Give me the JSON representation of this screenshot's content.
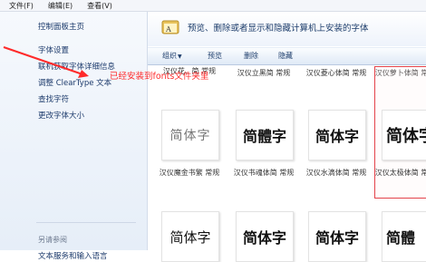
{
  "menubar": {
    "items": [
      "文件(F)",
      "编辑(E)",
      "查看(V)"
    ]
  },
  "sidebar": {
    "home": "控制面板主页",
    "links": [
      "字体设置",
      "联机获取字体详细信息",
      "调整 ClearType 文本",
      "查找字符",
      "更改字体大小"
    ],
    "see_also": "另请参阅",
    "bottom_link": "文本服务和输入语言"
  },
  "header": {
    "title": "预览、删除或者显示和隐藏计算机上安装的字体"
  },
  "toolbar": {
    "organize": "组织",
    "preview": "预览",
    "delete": "删除",
    "hide": "隐藏"
  },
  "fonts": {
    "row1": [
      {
        "name": "汉仪立黑简 常规",
        "sample": "简體字"
      },
      {
        "name": "汉仪菱心体简 常规",
        "sample": "简体字"
      },
      {
        "name": "汉仪萝卜体简 常规",
        "sample": "简体字"
      }
    ],
    "row1_partial_label": "汉仪花.. 简 常规",
    "row1_first_sample": "简体字",
    "row2": [
      {
        "name": "汉仪魔金书繁 常规",
        "sample": "简体字"
      },
      {
        "name": "汉仪书魂体简 常规",
        "sample": "简体字"
      },
      {
        "name": "汉仪水滴体简 常规",
        "sample": "简体字"
      },
      {
        "name": "汉仪太极体简 常规",
        "sample": "简體"
      }
    ]
  },
  "annotation": {
    "text": "已经安装到fonts文件夹里",
    "color": "#ff2a2a"
  }
}
